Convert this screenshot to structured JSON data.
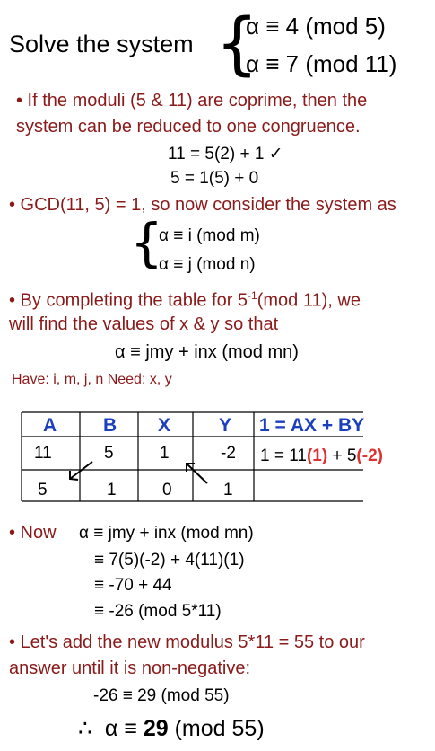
{
  "title": "Solve the system",
  "system": {
    "eq1": "α ≡ 4 (mod 5)",
    "eq2": "α ≡ 7 (mod 11)"
  },
  "note1": {
    "line1": "• If the moduli (5 & 11) are coprime, then the",
    "line2": "system can be reduced to one congruence."
  },
  "euclid": {
    "line1": "11 = 5(2) + 1 ✓",
    "line2": "5  = 1(5) + 0"
  },
  "note2": "• GCD(11, 5) = 1, so now consider the system as",
  "general_system": {
    "eq1": "α ≡ i  (mod m)",
    "eq2": "α ≡ j  (mod  n)"
  },
  "note3": {
    "prefix": "• By completing the table for 5",
    "superscript": "-1",
    "suffix": "(mod 11), we",
    "line2": "will find the values of x & y so that"
  },
  "formula": "α ≡ jmy + inx  (mod mn)",
  "have_need": "Have: i, m, j, n    Need: x, y",
  "table": {
    "headers": [
      "A",
      "B",
      "X",
      "Y",
      "1 = AX + BY"
    ],
    "rows": [
      [
        "11",
        "5",
        "1",
        "-2"
      ],
      [
        "5",
        "1",
        "0",
        "1"
      ]
    ],
    "equation": {
      "prefix": "1 = 11",
      "x_val": "(1)",
      "middle": " + 5",
      "y_val": "(-2)"
    }
  },
  "now": {
    "label": "• Now",
    "line1": "α ≡  jmy + inx  (mod mn)",
    "line2": "≡  7(5)(-2) + 4(11)(1)",
    "line3": "≡  -70 + 44",
    "line4": "≡  -26  (mod 5*11)"
  },
  "note4": {
    "line1": "• Let's add the new modulus  5*11 = 55  to our",
    "line2": "answer until it is non-negative:"
  },
  "adjust": "-26  ≡  29  (mod 55)",
  "final": {
    "therefore": "∴",
    "prefix": "α ≡ ",
    "value": "29",
    "suffix": "  (mod 55)"
  },
  "colors": {
    "dark_red": "#8b1a1a",
    "red": "#e03030",
    "blue": "#1c3fbf"
  }
}
